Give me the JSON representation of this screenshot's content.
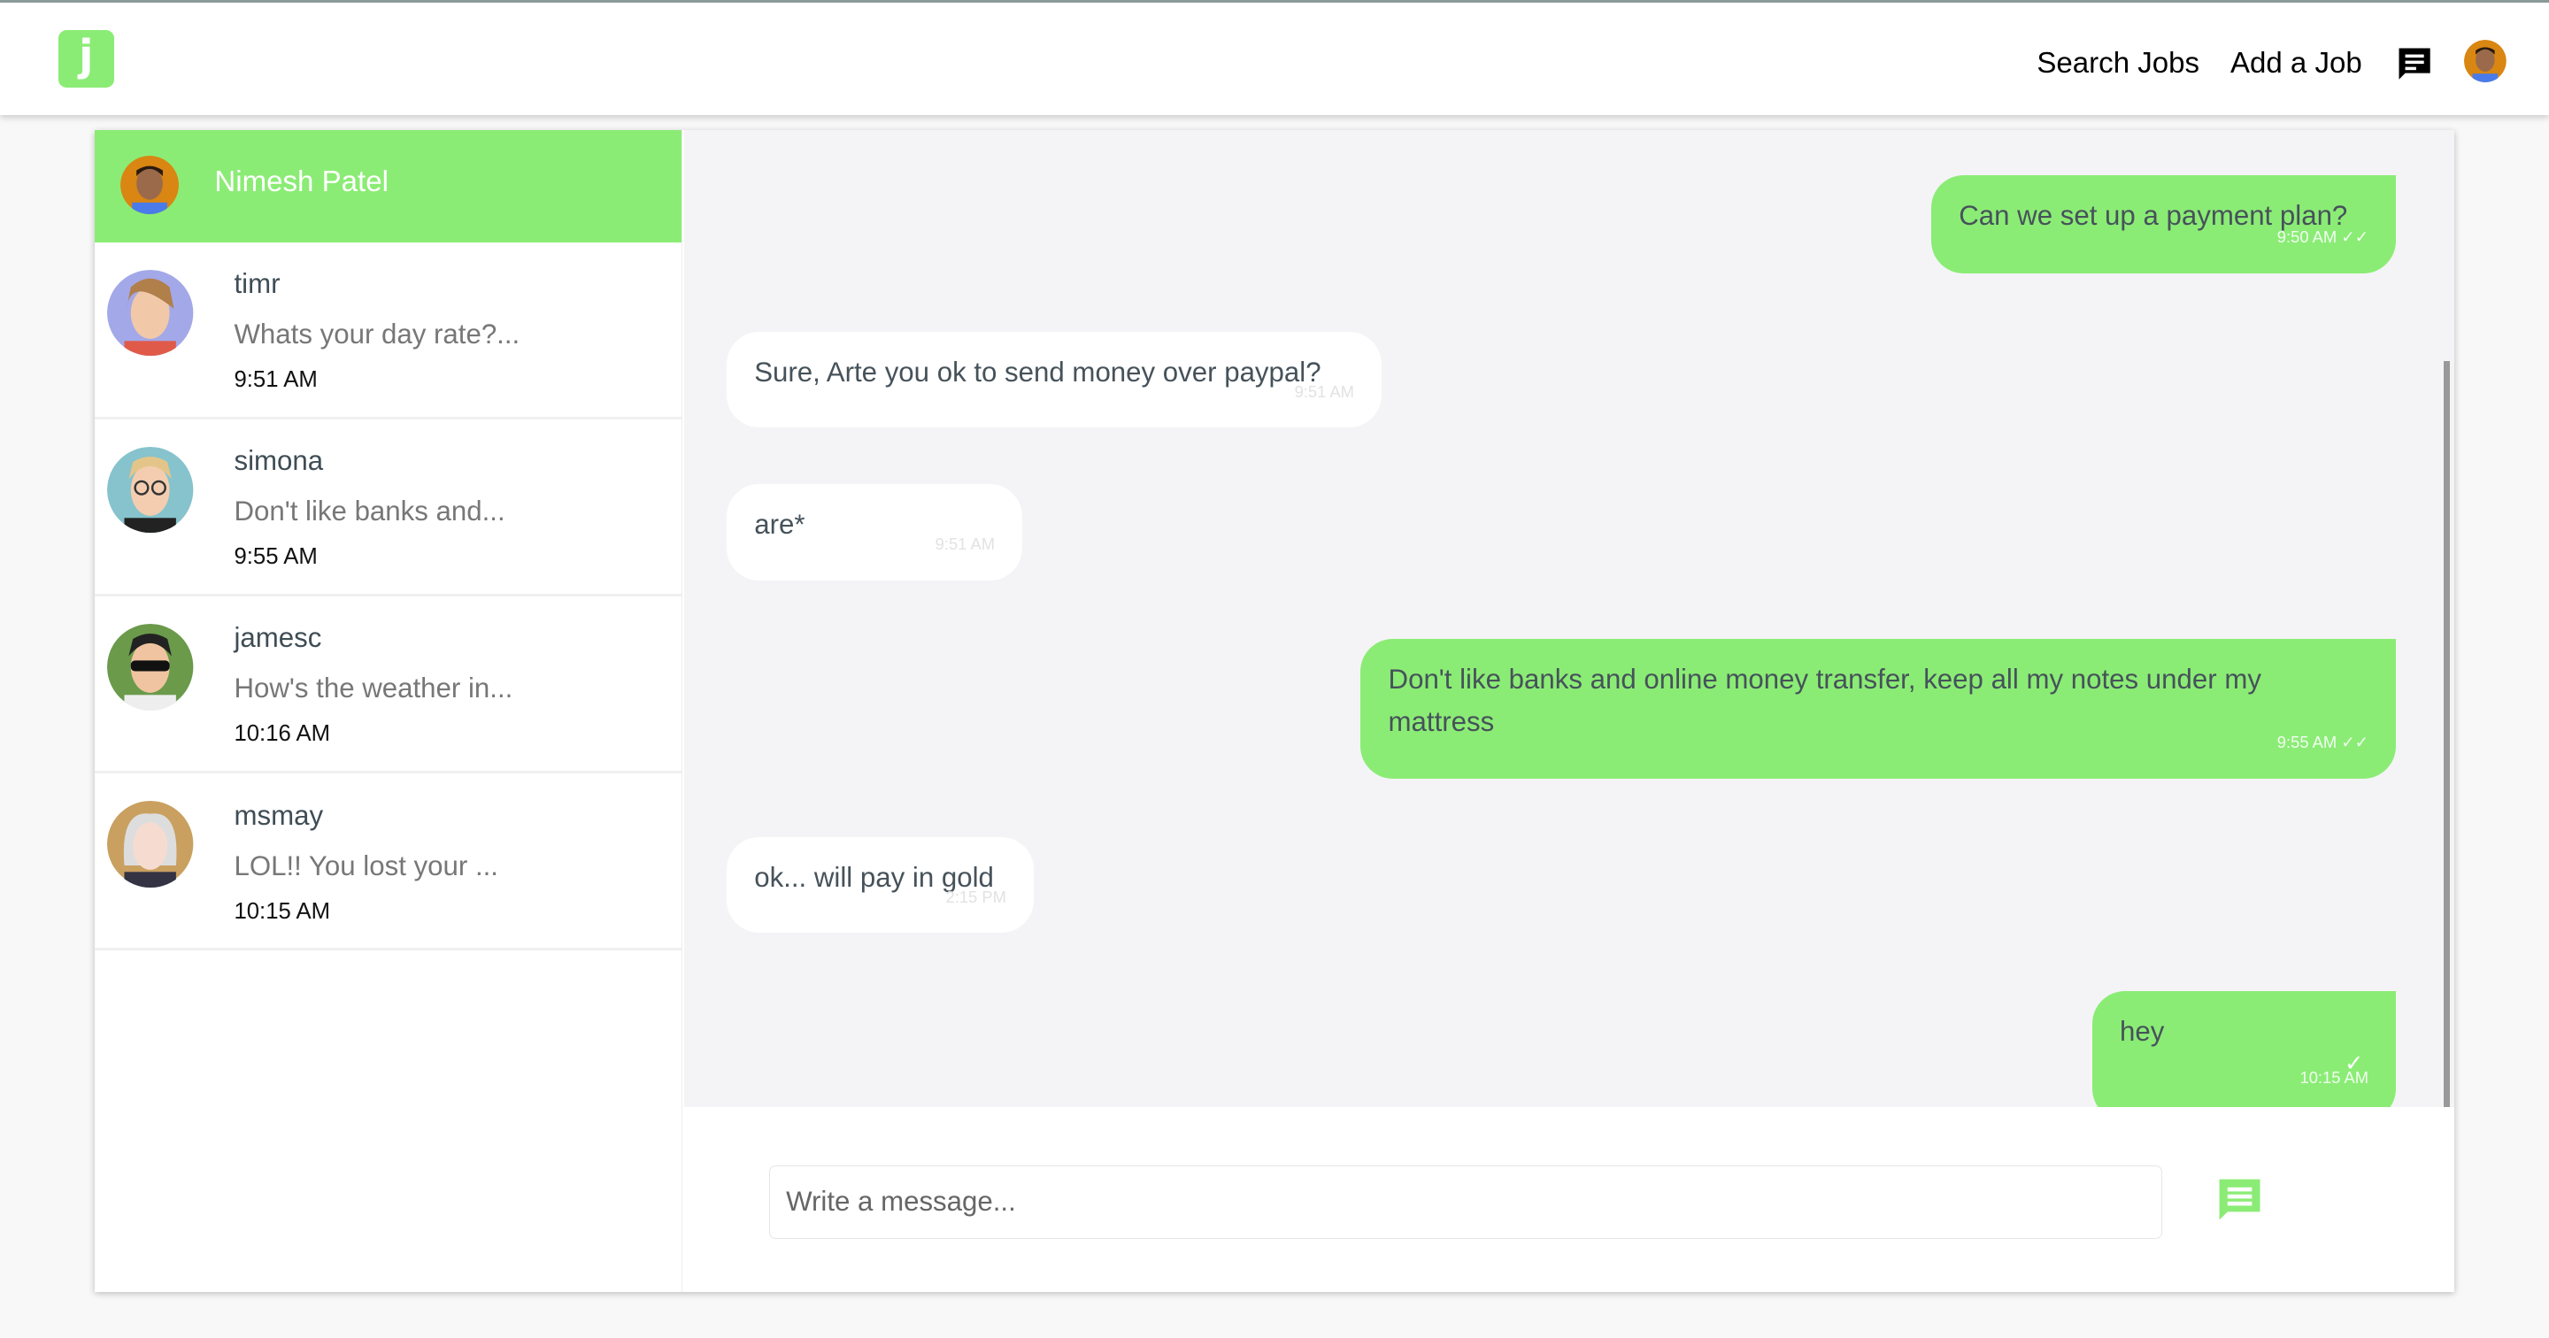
{
  "colors": {
    "accent": "#8bec75",
    "chat_bg": "#f4f4f6"
  },
  "header": {
    "logo": "j",
    "nav": [
      {
        "label": "Search Jobs"
      },
      {
        "label": "Add a Job"
      }
    ],
    "icons": [
      "chat-icon",
      "user-avatar"
    ]
  },
  "sidebar": {
    "current_user": "Nimesh Patel",
    "conversations": [
      {
        "name": "timr",
        "preview": "Whats your day rate?...",
        "time": "9:51 AM"
      },
      {
        "name": "simona",
        "preview": "Don't like banks and...",
        "time": "9:55 AM"
      },
      {
        "name": "jamesc",
        "preview": "How's the weather in...",
        "time": "10:16 AM"
      },
      {
        "name": "msmay",
        "preview": "LOL!! You lost your ...",
        "time": "10:15 AM"
      }
    ]
  },
  "messages": [
    {
      "from": "me",
      "text": "Can we set up a payment plan?",
      "time": "9:50 AM",
      "status": "read"
    },
    {
      "from": "them",
      "text": "Sure, Arte you ok to send money over paypal?",
      "time": "9:51 AM"
    },
    {
      "from": "them",
      "text": "are*",
      "time": "9:51 AM"
    },
    {
      "from": "me",
      "text": "Don't like banks and online money transfer, keep all my notes under my mattress",
      "time": "9:55 AM",
      "status": "read"
    },
    {
      "from": "them",
      "text": "ok... will pay in gold",
      "time": "2:15 PM"
    },
    {
      "from": "me",
      "text": "hey",
      "time": "10:15 AM",
      "status": "sent"
    }
  ],
  "composer": {
    "placeholder": "Write a message...",
    "value": ""
  }
}
